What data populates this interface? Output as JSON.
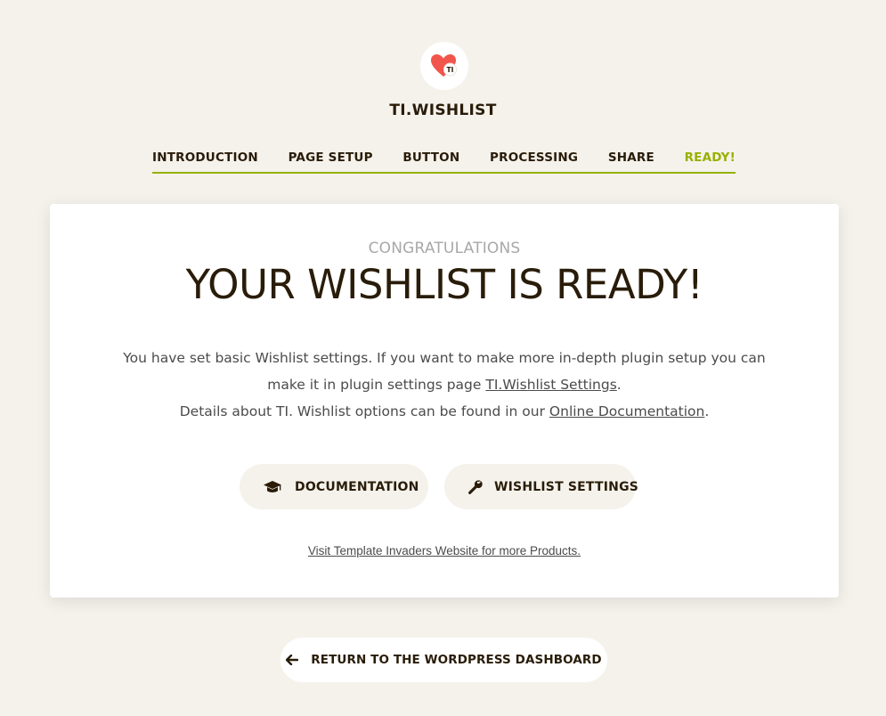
{
  "header": {
    "logo_badge": "TI",
    "brand": "TI.WISHLIST"
  },
  "steps": [
    {
      "label": "INTRODUCTION"
    },
    {
      "label": "PAGE SETUP"
    },
    {
      "label": "BUTTON"
    },
    {
      "label": "PROCESSING"
    },
    {
      "label": "SHARE"
    },
    {
      "label": "READY!"
    }
  ],
  "active_step": "READY!",
  "card": {
    "subtitle": "CONGRATULATIONS",
    "headline": "YOUR WISHLIST IS READY!",
    "desc_line1_prefix": "You have set basic Wishlist settings. If you want to make more in-depth plugin setup you can make it in plugin settings page ",
    "desc_settings_link": "TI.Wishlist Settings",
    "desc_line1_suffix": ".",
    "desc_line2_prefix": "Details about TI. Wishlist options can be found in our ",
    "desc_docs_link": "Online Documentation",
    "desc_line2_suffix": ".",
    "btn_documentation": "DOCUMENTATION",
    "btn_settings": "WISHLIST SETTINGS",
    "visit_link": "Visit Template Invaders Website for more Products."
  },
  "footer": {
    "return_label": "RETURN TO THE WORDPRESS DASHBOARD"
  },
  "colors": {
    "background": "#f5f2ec",
    "accent": "#96b100",
    "heart": "#f1554c",
    "text": "#291c09"
  },
  "icons": {
    "logo": "heart-icon",
    "documentation": "graduation-cap-icon",
    "settings": "wrench-icon",
    "return": "arrow-left-icon"
  }
}
